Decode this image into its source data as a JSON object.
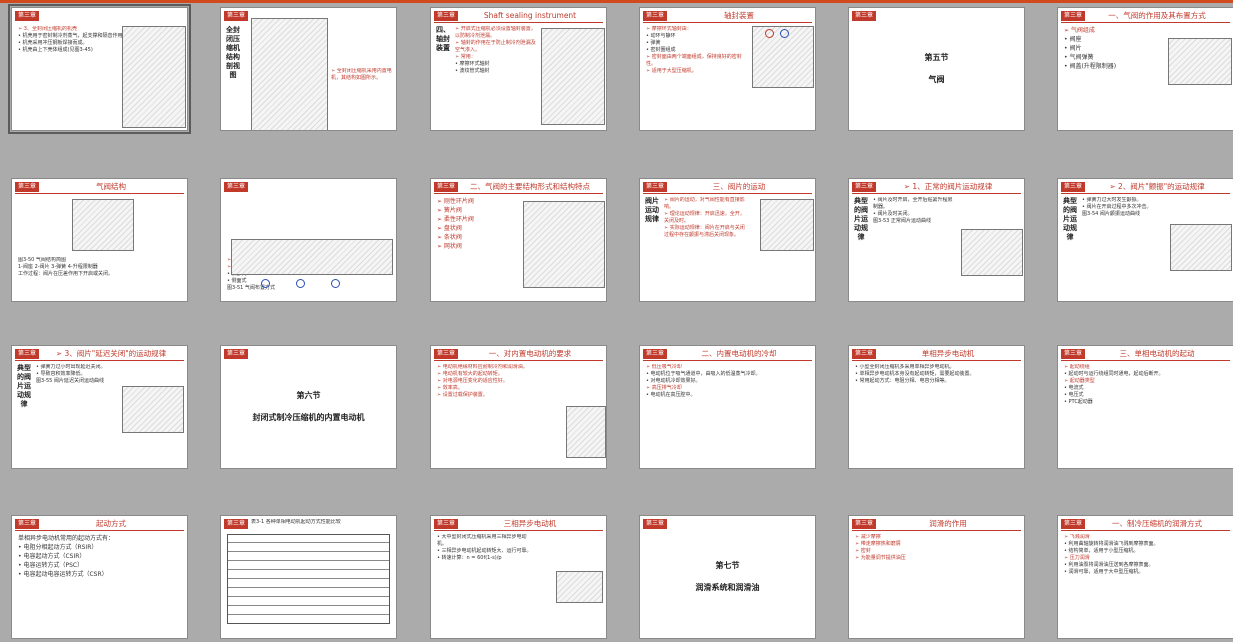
{
  "colors": {
    "accent": "#c0392b",
    "badge": "#c0392b"
  },
  "slides": [
    {
      "badge": "第三章",
      "title": "",
      "body": [
        "➢ 3、全封闭压缩机的机壳",
        "• 机壳用于密封制冷剂蒸气，起支撑和隔音作用。",
        "• 机壳采用冲压钢板焊接而成。",
        "• 机壳由上下壳体组成(见图3-45)"
      ]
    },
    {
      "badge": "第三章",
      "title": "",
      "vert": "全封闭压缩机结构剖视图",
      "body": [
        "➢ 全封闭压缩机采用内置电机，其结构如图所示。"
      ]
    },
    {
      "badge": "第三章",
      "title": "Shaft sealing instrument",
      "vert": "四、轴封装置",
      "body": [
        "➢ 开启式压缩机必须设置轴封装置，以防制冷剂泄漏。",
        "➢ 轴封的作用在于防止制冷剂泄漏及空气渗入。",
        "➢ 常用：",
        "• 摩擦环式轴封",
        "• 波纹管式轴封"
      ]
    },
    {
      "badge": "第三章",
      "title": "轴封装置",
      "body": [
        "➢ 摩擦环式轴封由：",
        "• 动环与静环",
        "• 弹簧",
        "• 密封圈组成",
        "➢ 密封面由两个端面组成，保持良好的密封性。",
        "➢ 适用于大型压缩机。"
      ]
    },
    {
      "badge": "第三章",
      "title": "",
      "center": [
        "第五节",
        "气阀"
      ],
      "body": []
    },
    {
      "badge": "第三章",
      "title": "一、气阀的作用及其布置方式",
      "body": [
        "➢ 气阀组成",
        "• 阀座",
        "• 阀片",
        "• 气阀弹簧",
        "• 阀盖(升程限制器)"
      ]
    },
    {
      "badge": "第三章",
      "title": "气阀结构",
      "body": [
        "图3-50 气阀结构简图",
        "1-阀座 2-阀片 3-弹簧 4-升程限制器",
        "工作过程：阀片在压差作用下开启或关闭。"
      ]
    },
    {
      "badge": "第三章",
      "title": "",
      "body": [
        "➢ 基本要求：气阀阻力小，关闭严密，寿命长。",
        "➢ 布置方式：",
        "• 顶部式",
        "• 侧面式",
        "图3-51 气阀布置方式"
      ]
    },
    {
      "badge": "第三章",
      "title": "二、气阀的主要结构形式和结构特点",
      "body": [
        "➢ 刚性环片阀",
        "➢ 簧片阀",
        "➢ 柔性环片阀",
        "➢ 盘状阀",
        "➢ 条状阀",
        "➢ 网状阀"
      ]
    },
    {
      "badge": "第三章",
      "title": "三、阀片的运动",
      "vert": "阀片运动规律",
      "body": [
        "➢ 阀片的运动，对气阀性能有直接影响。",
        "➢ 理论运动规律：开启迅速，全开，关闭及时。",
        "➢ 实际运动规律：阀片在开启与关闭过程中存在颤振与滞后关闭现象。"
      ]
    },
    {
      "badge": "第三章",
      "title": "➢ 1、正常的阀片运动规律",
      "vert": "典型的阀片运动规律",
      "body": [
        "• 阀片及时开启，全开后贴紧升程限制器。",
        "• 阀片及时关闭。",
        "图3-53 正常阀片运动曲线"
      ]
    },
    {
      "badge": "第三章",
      "title": "➢ 2、阀片\"颤振\"的运动规律",
      "vert": "典型的阀片运动规律",
      "body": [
        "• 弹簧力过大时发生颤振。",
        "• 阀片在开启过程中多次冲击。",
        "图3-54 阀片颤振运动曲线"
      ]
    },
    {
      "badge": "第三章",
      "title": "➢ 3、阀片\"延迟关闭\"的运动规律",
      "vert": "典型的阀片运动规律",
      "body": [
        "• 弹簧力过小时出现延迟关闭。",
        "• 导致容积效率降低。",
        "图3-55 阀片延迟关闭运动曲线"
      ]
    },
    {
      "badge": "第三章",
      "title": "",
      "center": [
        "第六节",
        "封闭式制冷压缩机的内置电动机"
      ],
      "body": []
    },
    {
      "badge": "第三章",
      "title": "一、对内置电动机的要求",
      "body": [
        "➢ 电动机绝缘材料应耐制冷剂和润滑油。",
        "➢ 电动机有较大的起动转矩。",
        "➢ 对电源电压变化的适应性好。",
        "➢ 效率高。",
        "➢ 设置过载保护装置。"
      ]
    },
    {
      "badge": "第三章",
      "title": "二、内置电动机的冷却",
      "body": [
        "➢ 低压吸气冷却",
        "• 电动机位于吸气通道中，由吸入的低温蒸气冷却。",
        "• 对电动机冷却效果好。",
        "➢ 高压排气冷却",
        "• 电动机在高压腔中。"
      ]
    },
    {
      "badge": "第三章",
      "title": "单相异步电动机",
      "body": [
        "• 小型全封闭压缩机多采用单相异步电动机。",
        "• 单相异步电动机本身没有起动转矩，需要起动装置。",
        "• 常用起动方式：电阻分相、电容分相等。"
      ]
    },
    {
      "badge": "第三章",
      "title": "三、单相电动机的起动",
      "body": [
        "➢ 起动绕组",
        "• 起动时与运行绕组同时通电，起动后断开。",
        "➢ 起动器类型",
        "• 电流式",
        "• 电压式",
        "• PTC起动器"
      ]
    },
    {
      "badge": "第三章",
      "title": "起动方式",
      "body": [
        "单相异步电动机常用的起动方式有：",
        "• 电阻分相起动方式（RSIR）",
        "• 电容起动方式（CSIR）",
        "• 电容运转方式（PSC）",
        "• 电容起动电容运转方式（CSR）"
      ]
    },
    {
      "badge": "第三章",
      "title": "",
      "body": [
        "表3-1 各种单相电动机起动方式性能比较"
      ]
    },
    {
      "badge": "第三章",
      "title": "三相异步电动机",
      "body": [
        "• 大中型封闭式压缩机采用三相异步电动机。",
        "• 三相异步电动机起动转矩大、运行可靠。",
        "• 转速计算：n = 60f(1-s)/p"
      ]
    },
    {
      "badge": "第三章",
      "title": "",
      "center": [
        "第七节",
        "润滑系统和润滑油"
      ],
      "body": []
    },
    {
      "badge": "第三章",
      "title": "润滑的作用",
      "body": [
        "➢ 减少摩擦",
        "➢ 带走摩擦热和磨屑",
        "➢ 密封",
        "➢ 为能量调节提供油压"
      ]
    },
    {
      "badge": "第三章",
      "title": "一、制冷压缩机的润滑方式",
      "body": [
        "➢ 飞溅润滑",
        "• 利用曲轴旋转将润滑油飞溅到摩擦表面。",
        "• 结构简单，适用于小型压缩机。",
        "➢ 压力润滑",
        "• 利用油泵将润滑油压送到各摩擦表面。",
        "• 润滑可靠，适用于大中型压缩机。"
      ]
    }
  ]
}
